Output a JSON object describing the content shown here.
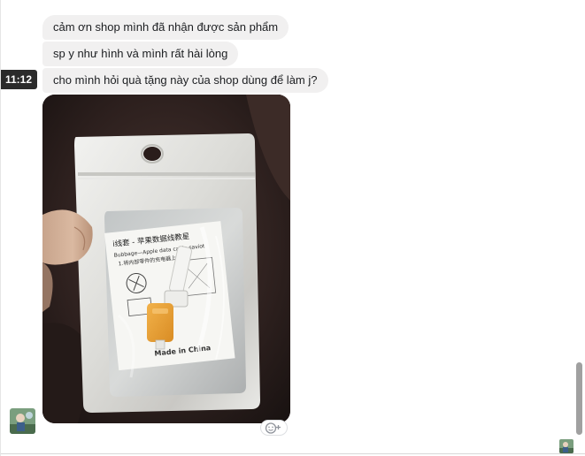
{
  "conversation": {
    "messages": [
      {
        "text": "cảm ơn shop mình đã nhận được sản phẩm"
      },
      {
        "text": "sp y như hình và mình rất hài lòng"
      },
      {
        "text": "cho mình hỏi quà tặng này của shop dùng để làm j?"
      }
    ],
    "timestamp": "11:12",
    "photo": {
      "package_text_line1": "i线套 - 苹果数据线教星",
      "package_text_line2": "Bubbage—Apple data cable saviot",
      "package_text_line3": "1.将内部零件的充电器上",
      "package_text_line4": "Made in China"
    }
  },
  "icons": {
    "reaction": "add-reaction-icon",
    "avatar": "sender-avatar",
    "seen": "seen-avatar"
  },
  "colors": {
    "bubble_bg": "#f1f0f0",
    "tooltip_bg": "#2b2b2b"
  }
}
